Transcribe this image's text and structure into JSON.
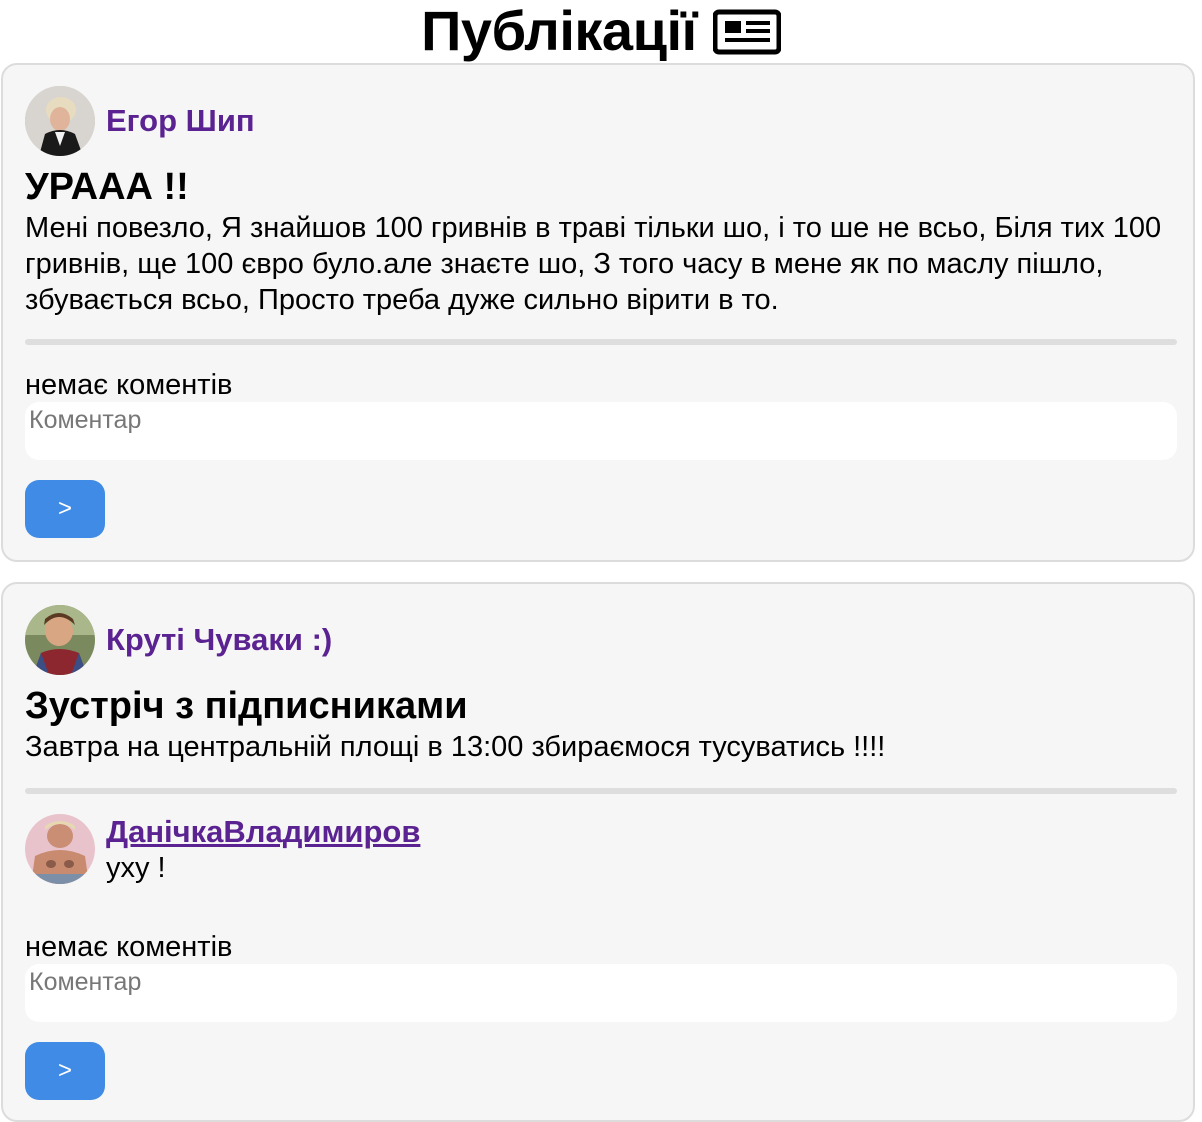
{
  "header": {
    "title": "Публікації",
    "icon": "newspaper-icon"
  },
  "posts": [
    {
      "author": {
        "name": "Егор Шип",
        "avatar": "avatar-photo"
      },
      "title": "УРААА !!",
      "body": "Мені повезло, Я знайшов 100 гривнів в траві тільки шо, і то ше не всьо, Біля тих 100 гривнів, ще 100 євро було.але знаєте шо, З того часу в мене як по маслу пішло, збувається всьо, Просто треба дуже сильно вірити в то.",
      "comments": [],
      "no_comments_label": "немає коментів",
      "comment_placeholder": "Коментар",
      "send_label": ">"
    },
    {
      "author": {
        "name": "Круті Чуваки :)",
        "avatar": "avatar-photo"
      },
      "title": "Зустріч з підписниками",
      "body": "Завтра на центральній площі в 13:00 збираємося тусуватись !!!!",
      "comments": [
        {
          "author": "ДанічкаВладимиров",
          "text": "ухy !"
        }
      ],
      "no_comments_label": "немає коментів",
      "comment_placeholder": "Коментар",
      "send_label": ">"
    }
  ],
  "colors": {
    "accent": "#3f8be6",
    "author_name": "#5b2391",
    "card_bg": "#f6f6f6",
    "card_border": "#dcdcdc"
  }
}
